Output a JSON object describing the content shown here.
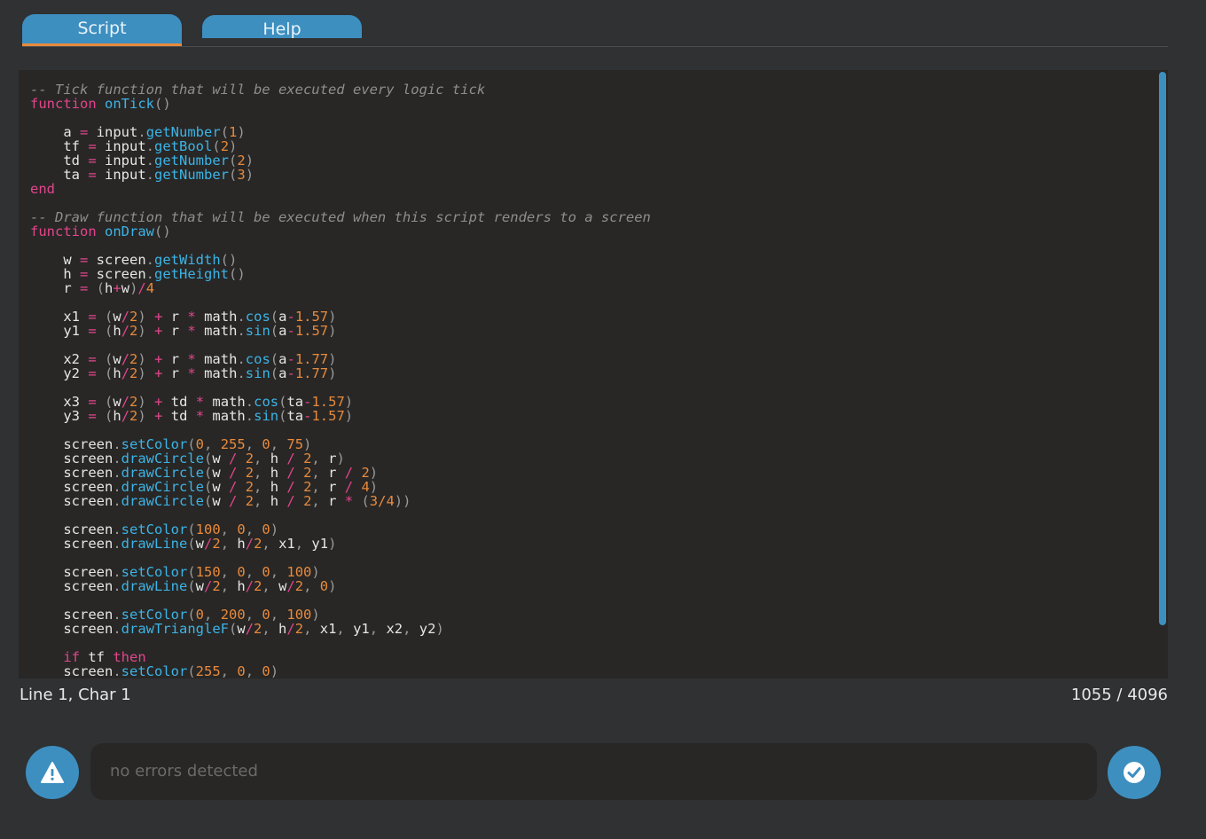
{
  "tabs": [
    {
      "label": "Script"
    },
    {
      "label": "Help"
    }
  ],
  "code_lines": [
    [
      [
        "c",
        "-- Tick function that will be executed every logic tick"
      ]
    ],
    [
      [
        "k",
        "function"
      ],
      [
        "t",
        " "
      ],
      [
        "f",
        "onTick"
      ],
      [
        "p",
        "()"
      ]
    ],
    [],
    [
      [
        "t",
        "    a "
      ],
      [
        "o",
        "="
      ],
      [
        "t",
        " input"
      ],
      [
        "p",
        "."
      ],
      [
        "f",
        "getNumber"
      ],
      [
        "p",
        "("
      ],
      [
        "n",
        "1"
      ],
      [
        "p",
        ")"
      ]
    ],
    [
      [
        "t",
        "    tf "
      ],
      [
        "o",
        "="
      ],
      [
        "t",
        " input"
      ],
      [
        "p",
        "."
      ],
      [
        "f",
        "getBool"
      ],
      [
        "p",
        "("
      ],
      [
        "n",
        "2"
      ],
      [
        "p",
        ")"
      ]
    ],
    [
      [
        "t",
        "    td "
      ],
      [
        "o",
        "="
      ],
      [
        "t",
        " input"
      ],
      [
        "p",
        "."
      ],
      [
        "f",
        "getNumber"
      ],
      [
        "p",
        "("
      ],
      [
        "n",
        "2"
      ],
      [
        "p",
        ")"
      ]
    ],
    [
      [
        "t",
        "    ta "
      ],
      [
        "o",
        "="
      ],
      [
        "t",
        " input"
      ],
      [
        "p",
        "."
      ],
      [
        "f",
        "getNumber"
      ],
      [
        "p",
        "("
      ],
      [
        "n",
        "3"
      ],
      [
        "p",
        ")"
      ]
    ],
    [
      [
        "k",
        "end"
      ]
    ],
    [],
    [
      [
        "c",
        "-- Draw function that will be executed when this script renders to a screen"
      ]
    ],
    [
      [
        "k",
        "function"
      ],
      [
        "t",
        " "
      ],
      [
        "f",
        "onDraw"
      ],
      [
        "p",
        "()"
      ]
    ],
    [],
    [
      [
        "t",
        "    w "
      ],
      [
        "o",
        "="
      ],
      [
        "t",
        " screen"
      ],
      [
        "p",
        "."
      ],
      [
        "f",
        "getWidth"
      ],
      [
        "p",
        "()"
      ]
    ],
    [
      [
        "t",
        "    h "
      ],
      [
        "o",
        "="
      ],
      [
        "t",
        " screen"
      ],
      [
        "p",
        "."
      ],
      [
        "f",
        "getHeight"
      ],
      [
        "p",
        "()"
      ]
    ],
    [
      [
        "t",
        "    r "
      ],
      [
        "o",
        "="
      ],
      [
        "t",
        " "
      ],
      [
        "p",
        "("
      ],
      [
        "t",
        "h"
      ],
      [
        "o",
        "+"
      ],
      [
        "t",
        "w"
      ],
      [
        "p",
        ")"
      ],
      [
        "o",
        "/"
      ],
      [
        "n",
        "4"
      ]
    ],
    [],
    [
      [
        "t",
        "    x1 "
      ],
      [
        "o",
        "="
      ],
      [
        "t",
        " "
      ],
      [
        "p",
        "("
      ],
      [
        "t",
        "w"
      ],
      [
        "o",
        "/"
      ],
      [
        "n",
        "2"
      ],
      [
        "p",
        ")"
      ],
      [
        "t",
        " "
      ],
      [
        "o",
        "+"
      ],
      [
        "t",
        " r "
      ],
      [
        "o",
        "*"
      ],
      [
        "t",
        " math"
      ],
      [
        "p",
        "."
      ],
      [
        "f",
        "cos"
      ],
      [
        "p",
        "("
      ],
      [
        "t",
        "a"
      ],
      [
        "o",
        "-"
      ],
      [
        "n",
        "1.57"
      ],
      [
        "p",
        ")"
      ]
    ],
    [
      [
        "t",
        "    y1 "
      ],
      [
        "o",
        "="
      ],
      [
        "t",
        " "
      ],
      [
        "p",
        "("
      ],
      [
        "t",
        "h"
      ],
      [
        "o",
        "/"
      ],
      [
        "n",
        "2"
      ],
      [
        "p",
        ")"
      ],
      [
        "t",
        " "
      ],
      [
        "o",
        "+"
      ],
      [
        "t",
        " r "
      ],
      [
        "o",
        "*"
      ],
      [
        "t",
        " math"
      ],
      [
        "p",
        "."
      ],
      [
        "f",
        "sin"
      ],
      [
        "p",
        "("
      ],
      [
        "t",
        "a"
      ],
      [
        "o",
        "-"
      ],
      [
        "n",
        "1.57"
      ],
      [
        "p",
        ")"
      ]
    ],
    [],
    [
      [
        "t",
        "    x2 "
      ],
      [
        "o",
        "="
      ],
      [
        "t",
        " "
      ],
      [
        "p",
        "("
      ],
      [
        "t",
        "w"
      ],
      [
        "o",
        "/"
      ],
      [
        "n",
        "2"
      ],
      [
        "p",
        ")"
      ],
      [
        "t",
        " "
      ],
      [
        "o",
        "+"
      ],
      [
        "t",
        " r "
      ],
      [
        "o",
        "*"
      ],
      [
        "t",
        " math"
      ],
      [
        "p",
        "."
      ],
      [
        "f",
        "cos"
      ],
      [
        "p",
        "("
      ],
      [
        "t",
        "a"
      ],
      [
        "o",
        "-"
      ],
      [
        "n",
        "1.77"
      ],
      [
        "p",
        ")"
      ]
    ],
    [
      [
        "t",
        "    y2 "
      ],
      [
        "o",
        "="
      ],
      [
        "t",
        " "
      ],
      [
        "p",
        "("
      ],
      [
        "t",
        "h"
      ],
      [
        "o",
        "/"
      ],
      [
        "n",
        "2"
      ],
      [
        "p",
        ")"
      ],
      [
        "t",
        " "
      ],
      [
        "o",
        "+"
      ],
      [
        "t",
        " r "
      ],
      [
        "o",
        "*"
      ],
      [
        "t",
        " math"
      ],
      [
        "p",
        "."
      ],
      [
        "f",
        "sin"
      ],
      [
        "p",
        "("
      ],
      [
        "t",
        "a"
      ],
      [
        "o",
        "-"
      ],
      [
        "n",
        "1.77"
      ],
      [
        "p",
        ")"
      ]
    ],
    [],
    [
      [
        "t",
        "    x3 "
      ],
      [
        "o",
        "="
      ],
      [
        "t",
        " "
      ],
      [
        "p",
        "("
      ],
      [
        "t",
        "w"
      ],
      [
        "o",
        "/"
      ],
      [
        "n",
        "2"
      ],
      [
        "p",
        ")"
      ],
      [
        "t",
        " "
      ],
      [
        "o",
        "+"
      ],
      [
        "t",
        " td "
      ],
      [
        "o",
        "*"
      ],
      [
        "t",
        " math"
      ],
      [
        "p",
        "."
      ],
      [
        "f",
        "cos"
      ],
      [
        "p",
        "("
      ],
      [
        "t",
        "ta"
      ],
      [
        "o",
        "-"
      ],
      [
        "n",
        "1.57"
      ],
      [
        "p",
        ")"
      ]
    ],
    [
      [
        "t",
        "    y3 "
      ],
      [
        "o",
        "="
      ],
      [
        "t",
        " "
      ],
      [
        "p",
        "("
      ],
      [
        "t",
        "h"
      ],
      [
        "o",
        "/"
      ],
      [
        "n",
        "2"
      ],
      [
        "p",
        ")"
      ],
      [
        "t",
        " "
      ],
      [
        "o",
        "+"
      ],
      [
        "t",
        " td "
      ],
      [
        "o",
        "*"
      ],
      [
        "t",
        " math"
      ],
      [
        "p",
        "."
      ],
      [
        "f",
        "sin"
      ],
      [
        "p",
        "("
      ],
      [
        "t",
        "ta"
      ],
      [
        "o",
        "-"
      ],
      [
        "n",
        "1.57"
      ],
      [
        "p",
        ")"
      ]
    ],
    [],
    [
      [
        "t",
        "    screen"
      ],
      [
        "p",
        "."
      ],
      [
        "f",
        "setColor"
      ],
      [
        "p",
        "("
      ],
      [
        "n",
        "0"
      ],
      [
        "p",
        ", "
      ],
      [
        "n",
        "255"
      ],
      [
        "p",
        ", "
      ],
      [
        "n",
        "0"
      ],
      [
        "p",
        ", "
      ],
      [
        "n",
        "75"
      ],
      [
        "p",
        ")"
      ]
    ],
    [
      [
        "t",
        "    screen"
      ],
      [
        "p",
        "."
      ],
      [
        "f",
        "drawCircle"
      ],
      [
        "p",
        "("
      ],
      [
        "t",
        "w "
      ],
      [
        "o",
        "/"
      ],
      [
        "t",
        " "
      ],
      [
        "n",
        "2"
      ],
      [
        "p",
        ", "
      ],
      [
        "t",
        "h "
      ],
      [
        "o",
        "/"
      ],
      [
        "t",
        " "
      ],
      [
        "n",
        "2"
      ],
      [
        "p",
        ", "
      ],
      [
        "t",
        "r"
      ],
      [
        "p",
        ")"
      ]
    ],
    [
      [
        "t",
        "    screen"
      ],
      [
        "p",
        "."
      ],
      [
        "f",
        "drawCircle"
      ],
      [
        "p",
        "("
      ],
      [
        "t",
        "w "
      ],
      [
        "o",
        "/"
      ],
      [
        "t",
        " "
      ],
      [
        "n",
        "2"
      ],
      [
        "p",
        ", "
      ],
      [
        "t",
        "h "
      ],
      [
        "o",
        "/"
      ],
      [
        "t",
        " "
      ],
      [
        "n",
        "2"
      ],
      [
        "p",
        ", "
      ],
      [
        "t",
        "r "
      ],
      [
        "o",
        "/"
      ],
      [
        "t",
        " "
      ],
      [
        "n",
        "2"
      ],
      [
        "p",
        ")"
      ]
    ],
    [
      [
        "t",
        "    screen"
      ],
      [
        "p",
        "."
      ],
      [
        "f",
        "drawCircle"
      ],
      [
        "p",
        "("
      ],
      [
        "t",
        "w "
      ],
      [
        "o",
        "/"
      ],
      [
        "t",
        " "
      ],
      [
        "n",
        "2"
      ],
      [
        "p",
        ", "
      ],
      [
        "t",
        "h "
      ],
      [
        "o",
        "/"
      ],
      [
        "t",
        " "
      ],
      [
        "n",
        "2"
      ],
      [
        "p",
        ", "
      ],
      [
        "t",
        "r "
      ],
      [
        "o",
        "/"
      ],
      [
        "t",
        " "
      ],
      [
        "n",
        "4"
      ],
      [
        "p",
        ")"
      ]
    ],
    [
      [
        "t",
        "    screen"
      ],
      [
        "p",
        "."
      ],
      [
        "f",
        "drawCircle"
      ],
      [
        "p",
        "("
      ],
      [
        "t",
        "w "
      ],
      [
        "o",
        "/"
      ],
      [
        "t",
        " "
      ],
      [
        "n",
        "2"
      ],
      [
        "p",
        ", "
      ],
      [
        "t",
        "h "
      ],
      [
        "o",
        "/"
      ],
      [
        "t",
        " "
      ],
      [
        "n",
        "2"
      ],
      [
        "p",
        ", "
      ],
      [
        "t",
        "r "
      ],
      [
        "o",
        "*"
      ],
      [
        "t",
        " "
      ],
      [
        "p",
        "("
      ],
      [
        "n",
        "3/4"
      ],
      [
        "p",
        "))"
      ]
    ],
    [],
    [
      [
        "t",
        "    screen"
      ],
      [
        "p",
        "."
      ],
      [
        "f",
        "setColor"
      ],
      [
        "p",
        "("
      ],
      [
        "n",
        "100"
      ],
      [
        "p",
        ", "
      ],
      [
        "n",
        "0"
      ],
      [
        "p",
        ", "
      ],
      [
        "n",
        "0"
      ],
      [
        "p",
        ")"
      ]
    ],
    [
      [
        "t",
        "    screen"
      ],
      [
        "p",
        "."
      ],
      [
        "f",
        "drawLine"
      ],
      [
        "p",
        "("
      ],
      [
        "t",
        "w"
      ],
      [
        "o",
        "/"
      ],
      [
        "n",
        "2"
      ],
      [
        "p",
        ", "
      ],
      [
        "t",
        "h"
      ],
      [
        "o",
        "/"
      ],
      [
        "n",
        "2"
      ],
      [
        "p",
        ", "
      ],
      [
        "t",
        "x1"
      ],
      [
        "p",
        ", "
      ],
      [
        "t",
        "y1"
      ],
      [
        "p",
        ")"
      ]
    ],
    [],
    [
      [
        "t",
        "    screen"
      ],
      [
        "p",
        "."
      ],
      [
        "f",
        "setColor"
      ],
      [
        "p",
        "("
      ],
      [
        "n",
        "150"
      ],
      [
        "p",
        ", "
      ],
      [
        "n",
        "0"
      ],
      [
        "p",
        ", "
      ],
      [
        "n",
        "0"
      ],
      [
        "p",
        ", "
      ],
      [
        "n",
        "100"
      ],
      [
        "p",
        ")"
      ]
    ],
    [
      [
        "t",
        "    screen"
      ],
      [
        "p",
        "."
      ],
      [
        "f",
        "drawLine"
      ],
      [
        "p",
        "("
      ],
      [
        "t",
        "w"
      ],
      [
        "o",
        "/"
      ],
      [
        "n",
        "2"
      ],
      [
        "p",
        ", "
      ],
      [
        "t",
        "h"
      ],
      [
        "o",
        "/"
      ],
      [
        "n",
        "2"
      ],
      [
        "p",
        ", "
      ],
      [
        "t",
        "w"
      ],
      [
        "o",
        "/"
      ],
      [
        "n",
        "2"
      ],
      [
        "p",
        ", "
      ],
      [
        "n",
        "0"
      ],
      [
        "p",
        ")"
      ]
    ],
    [],
    [
      [
        "t",
        "    screen"
      ],
      [
        "p",
        "."
      ],
      [
        "f",
        "setColor"
      ],
      [
        "p",
        "("
      ],
      [
        "n",
        "0"
      ],
      [
        "p",
        ", "
      ],
      [
        "n",
        "200"
      ],
      [
        "p",
        ", "
      ],
      [
        "n",
        "0"
      ],
      [
        "p",
        ", "
      ],
      [
        "n",
        "100"
      ],
      [
        "p",
        ")"
      ]
    ],
    [
      [
        "t",
        "    screen"
      ],
      [
        "p",
        "."
      ],
      [
        "f",
        "drawTriangleF"
      ],
      [
        "p",
        "("
      ],
      [
        "t",
        "w"
      ],
      [
        "o",
        "/"
      ],
      [
        "n",
        "2"
      ],
      [
        "p",
        ", "
      ],
      [
        "t",
        "h"
      ],
      [
        "o",
        "/"
      ],
      [
        "n",
        "2"
      ],
      [
        "p",
        ", "
      ],
      [
        "t",
        "x1"
      ],
      [
        "p",
        ", "
      ],
      [
        "t",
        "y1"
      ],
      [
        "p",
        ", "
      ],
      [
        "t",
        "x2"
      ],
      [
        "p",
        ", "
      ],
      [
        "t",
        "y2"
      ],
      [
        "p",
        ")"
      ]
    ],
    [],
    [
      [
        "t",
        "    "
      ],
      [
        "k",
        "if"
      ],
      [
        "t",
        " tf "
      ],
      [
        "k",
        "then"
      ]
    ],
    [
      [
        "t",
        "    screen"
      ],
      [
        "p",
        "."
      ],
      [
        "f",
        "setColor"
      ],
      [
        "p",
        "("
      ],
      [
        "n",
        "255"
      ],
      [
        "p",
        ", "
      ],
      [
        "n",
        "0"
      ],
      [
        "p",
        ", "
      ],
      [
        "n",
        "0"
      ],
      [
        "p",
        ")"
      ]
    ]
  ],
  "status": {
    "position": "Line 1, Char 1",
    "count": "1055 / 4096"
  },
  "errors": {
    "message": "no errors detected"
  },
  "icons": {
    "warning": "warning-triangle-icon",
    "confirm": "checkmark-circle-icon"
  },
  "colors": {
    "accent": "#3d8fc0",
    "active_tab_underline": "#e88a3c",
    "keyword": "#e2458c",
    "function": "#3cb4e6",
    "number": "#e88a3c",
    "comment": "#8e8e8e"
  }
}
